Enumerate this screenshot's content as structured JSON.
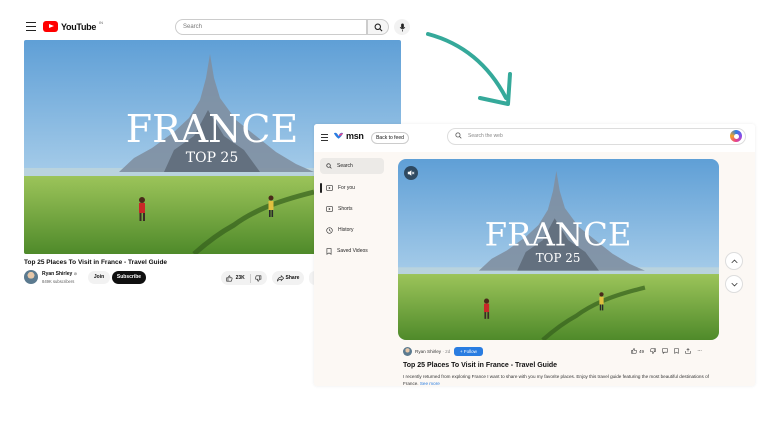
{
  "youtube": {
    "logo_text": "YouTube",
    "logo_sup": "IN",
    "search_placeholder": "Search",
    "video": {
      "overlay_title": "FRANCE",
      "overlay_subtitle": "TOP 25"
    },
    "title": "Top 25 Places To Visit in France - Travel Guide",
    "channel": "Ryan Shirley",
    "verified_mark": "⊘",
    "subscribers": "849K subscribers",
    "join_label": "Join",
    "subscribe_label": "Subscribe",
    "likes": "23K",
    "share_label": "Share"
  },
  "msn": {
    "logo_text": "msn",
    "back_label": "Back to feed",
    "search_placeholder": "Search the web",
    "sidebar": [
      {
        "label": "Search",
        "icon": "search-icon"
      },
      {
        "label": "For you",
        "icon": "play-square-icon"
      },
      {
        "label": "Shorts",
        "icon": "play-square-icon"
      },
      {
        "label": "History",
        "icon": "history-icon"
      },
      {
        "label": "Saved Videos",
        "icon": "bookmark-icon"
      }
    ],
    "video": {
      "overlay_title": "FRANCE",
      "overlay_subtitle": "TOP 25"
    },
    "channel": "Ryan Shirley",
    "age": "· 2d",
    "follow_label": "+ Follow",
    "likes": "49",
    "title": "Top 25 Places To Visit in France - Travel Guide",
    "description": "I recently returned from exploring France I want to share with you my favorite places. Enjoy this travel guide featuring the most beautiful destinations of France.",
    "see_more": "See more"
  },
  "colors": {
    "youtube_red": "#ff0000",
    "msn_accent": "#2a7de1",
    "arrow": "#35a99a"
  }
}
